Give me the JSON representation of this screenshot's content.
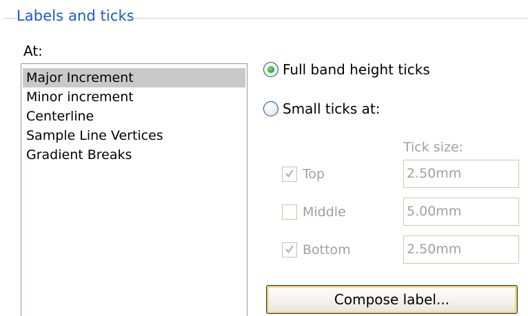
{
  "group": {
    "title": "Labels and ticks"
  },
  "at_list": {
    "label": "At:",
    "items": [
      "Major Increment",
      "Minor increment",
      "Centerline",
      "Sample Line Vertices",
      "Gradient Breaks"
    ],
    "selected_index": 0
  },
  "tick_mode": {
    "full_label": "Full band height ticks",
    "small_label": "Small ticks at:",
    "selected": "full"
  },
  "tick_size": {
    "header": "Tick size:",
    "rows": [
      {
        "label": "Top",
        "checked": true,
        "value": "2.50mm"
      },
      {
        "label": "Middle",
        "checked": false,
        "value": "5.00mm"
      },
      {
        "label": "Bottom",
        "checked": true,
        "value": "2.50mm"
      }
    ]
  },
  "compose_button": {
    "label": "Compose label..."
  },
  "colors": {
    "group_title": "#1a56d1",
    "selection": "#c9c9c9",
    "disabled_text": "#a0a0a0",
    "radio_dot": "#2faa2f",
    "button_focus": "#f9c557"
  }
}
